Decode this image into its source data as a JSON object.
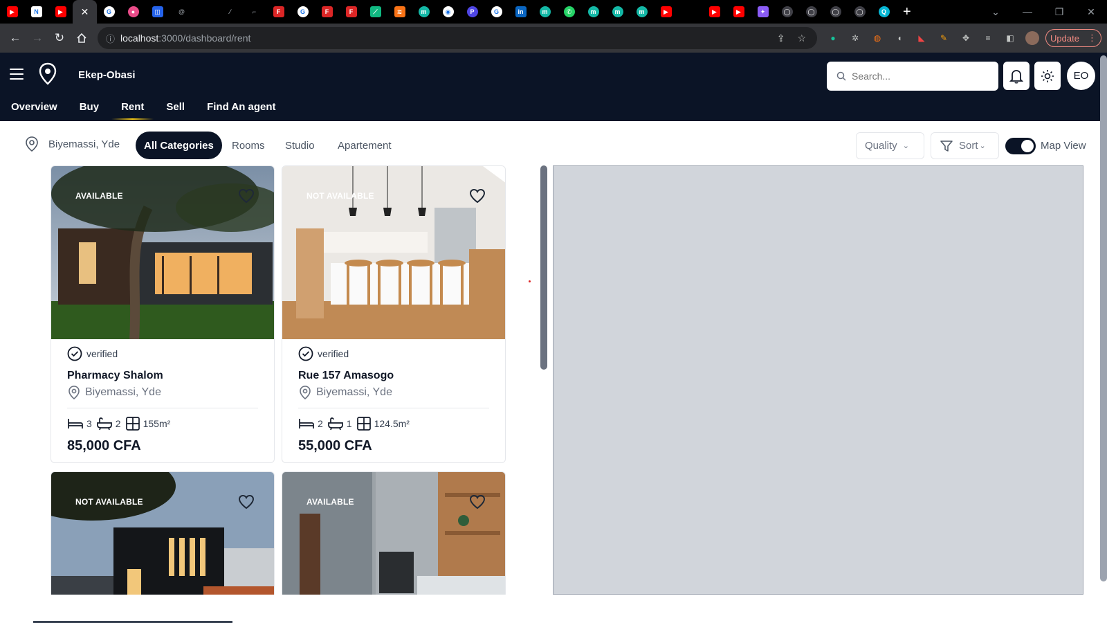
{
  "browser": {
    "url_host": "localhost",
    "url_path": ":3000/dashboard/rent",
    "update_label": "Update",
    "tab_favicons": [
      {
        "name": "youtube-icon",
        "color": "#ff0000",
        "glyph": "▶"
      },
      {
        "name": "notion-icon",
        "color": "#ffffff",
        "glyph": "N"
      },
      {
        "name": "youtube-icon",
        "color": "#ff0000",
        "glyph": "▶"
      },
      {
        "name": "close-icon",
        "color": "",
        "glyph": "✕"
      },
      {
        "name": "google-icon",
        "color": "#ffffff",
        "glyph": "G"
      },
      {
        "name": "dribbble-icon",
        "color": "#ea4c89",
        "glyph": "●"
      },
      {
        "name": "app-icon",
        "color": "#2563eb",
        "glyph": "◫"
      },
      {
        "name": "threads-icon",
        "color": "#000000",
        "glyph": "@"
      },
      {
        "name": "blank-icon",
        "color": "#000000",
        "glyph": ""
      },
      {
        "name": "vercel-icon",
        "color": "#000000",
        "glyph": "⁄"
      },
      {
        "name": "blank-icon",
        "color": "#000000",
        "glyph": "⌐"
      },
      {
        "name": "figma-icon",
        "color": "#dc2626",
        "glyph": "F"
      },
      {
        "name": "google-icon",
        "color": "#ffffff",
        "glyph": "G"
      },
      {
        "name": "figma-icon",
        "color": "#dc2626",
        "glyph": "F"
      },
      {
        "name": "figma-icon",
        "color": "#dc2626",
        "glyph": "F"
      },
      {
        "name": "feather-icon",
        "color": "#10b981",
        "glyph": "⟋"
      },
      {
        "name": "flame-icon",
        "color": "#f97316",
        "glyph": "≋"
      },
      {
        "name": "m-icon",
        "color": "#14b8a6",
        "glyph": "m"
      },
      {
        "name": "compass-icon",
        "color": "#ffffff",
        "glyph": "◉"
      },
      {
        "name": "p-icon",
        "color": "#4f46e5",
        "glyph": "P"
      },
      {
        "name": "google-icon",
        "color": "#ffffff",
        "glyph": "G"
      },
      {
        "name": "linkedin-icon",
        "color": "#0a66c2",
        "glyph": "in"
      },
      {
        "name": "m-icon",
        "color": "#14b8a6",
        "glyph": "m"
      },
      {
        "name": "whatsapp-icon",
        "color": "#25d366",
        "glyph": "✆"
      },
      {
        "name": "m-icon",
        "color": "#14b8a6",
        "glyph": "m"
      },
      {
        "name": "m-icon",
        "color": "#14b8a6",
        "glyph": "m"
      },
      {
        "name": "m-icon",
        "color": "#14b8a6",
        "glyph": "m"
      },
      {
        "name": "youtube-icon",
        "color": "#ff0000",
        "glyph": "▶"
      },
      {
        "name": "blank-icon",
        "color": "#000000",
        "glyph": ""
      },
      {
        "name": "youtube-icon",
        "color": "#ff0000",
        "glyph": "▶"
      },
      {
        "name": "youtube-icon",
        "color": "#ff0000",
        "glyph": "▶"
      },
      {
        "name": "gemini-icon",
        "color": "#8b5cf6",
        "glyph": "✦"
      },
      {
        "name": "github-icon",
        "color": "#3f3f46",
        "glyph": "◯"
      },
      {
        "name": "github-icon",
        "color": "#3f3f46",
        "glyph": "◯"
      },
      {
        "name": "github-icon",
        "color": "#3f3f46",
        "glyph": "◯"
      },
      {
        "name": "github-icon",
        "color": "#3f3f46",
        "glyph": "◯"
      },
      {
        "name": "q-icon",
        "color": "#06b6d4",
        "glyph": "Q"
      }
    ]
  },
  "header": {
    "brand": "Ekep-Obasi",
    "nav": [
      "Overview",
      "Buy",
      "Rent",
      "Sell",
      "Find An agent"
    ],
    "active_nav": "Rent",
    "search_placeholder": "Search...",
    "avatar_initials": "EO",
    "bg_color": "#0b1426"
  },
  "filters": {
    "location": "Biyemassi, Yde",
    "categories": [
      "All Categories",
      "Rooms",
      "Studio",
      "Apartement"
    ],
    "active_category": "All Categories",
    "quality_label": "Quality",
    "sort_label": "Sort",
    "map_view_label": "Map View",
    "map_view_on": true
  },
  "listings": [
    {
      "status": "AVAILABLE",
      "verified_label": "verified",
      "title": "Pharmacy Shalom",
      "location": "Biyemassi, Yde",
      "beds": "3",
      "baths": "2",
      "area": "155m²",
      "price": "85,000 CFA"
    },
    {
      "status": "NOT AVAILABLE",
      "verified_label": "verified",
      "title": "Rue 157 Amasogo",
      "location": "Biyemassi, Yde",
      "beds": "2",
      "baths": "1",
      "area": "124.5m²",
      "price": "55,000 CFA"
    },
    {
      "status": "NOT AVAILABLE"
    },
    {
      "status": "AVAILABLE"
    }
  ]
}
